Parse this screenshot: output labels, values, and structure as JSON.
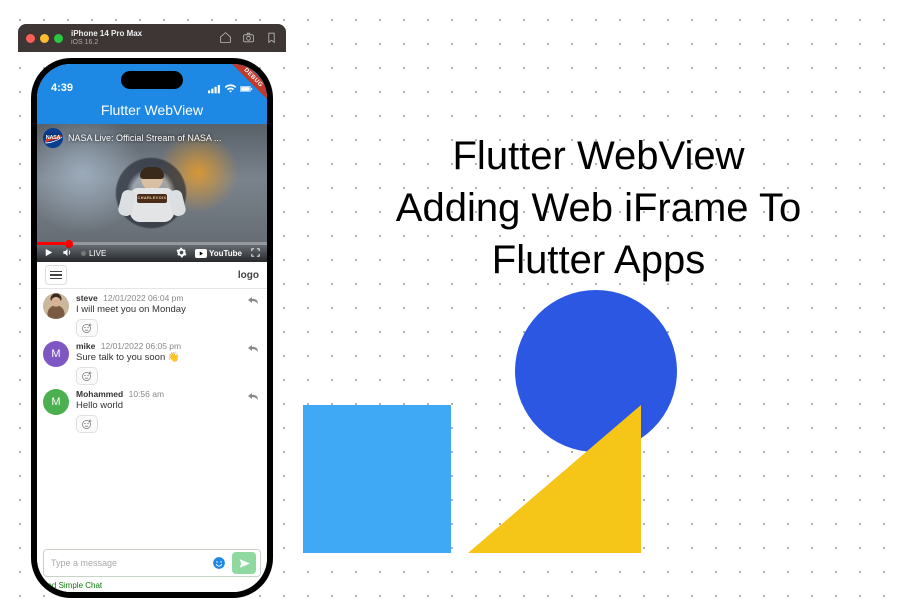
{
  "promo": {
    "line1": "Flutter WebView",
    "line2": "Adding Web iFrame To",
    "line3": "Flutter Apps"
  },
  "simulator": {
    "device": "iPhone 14 Pro Max",
    "ios": "iOS 16.2"
  },
  "statusbar": {
    "time": "4:39"
  },
  "appbar": {
    "title": "Flutter WebView"
  },
  "debug_label": "DEBUG",
  "youtube": {
    "channel_initial": "NASA",
    "title": "NASA Live: Official Stream of NASA ...",
    "live_label": "LIVE",
    "brand": "YouTube",
    "astronaut_shirt": "CHARLEVOIX"
  },
  "chat": {
    "header_left_icon": "menu",
    "header_logo": "logo",
    "composer_placeholder": "Type a message",
    "messages": [
      {
        "name": "steve",
        "time": "12/01/2022 06:04 pm",
        "text": "I will meet you on Monday",
        "avatar_initial": ""
      },
      {
        "name": "mike",
        "time": "12/01/2022 06:05 pm",
        "text": "Sure talk to you soon 👋",
        "avatar_initial": "M"
      },
      {
        "name": "Mohammed",
        "time": "10:56 am",
        "text": "Hello world",
        "avatar_initial": "M"
      }
    ],
    "bottom_link": "ead Simple Chat"
  }
}
